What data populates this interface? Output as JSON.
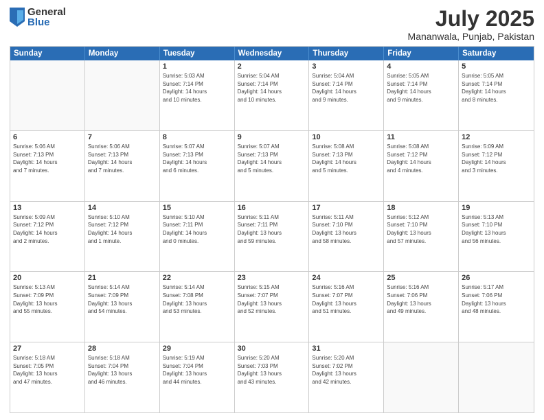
{
  "logo": {
    "general": "General",
    "blue": "Blue"
  },
  "header": {
    "month": "July 2025",
    "location": "Mananwala, Punjab, Pakistan"
  },
  "weekdays": [
    "Sunday",
    "Monday",
    "Tuesday",
    "Wednesday",
    "Thursday",
    "Friday",
    "Saturday"
  ],
  "weeks": [
    [
      {
        "day": "",
        "info": ""
      },
      {
        "day": "",
        "info": ""
      },
      {
        "day": "1",
        "info": "Sunrise: 5:03 AM\nSunset: 7:14 PM\nDaylight: 14 hours\nand 10 minutes."
      },
      {
        "day": "2",
        "info": "Sunrise: 5:04 AM\nSunset: 7:14 PM\nDaylight: 14 hours\nand 10 minutes."
      },
      {
        "day": "3",
        "info": "Sunrise: 5:04 AM\nSunset: 7:14 PM\nDaylight: 14 hours\nand 9 minutes."
      },
      {
        "day": "4",
        "info": "Sunrise: 5:05 AM\nSunset: 7:14 PM\nDaylight: 14 hours\nand 9 minutes."
      },
      {
        "day": "5",
        "info": "Sunrise: 5:05 AM\nSunset: 7:14 PM\nDaylight: 14 hours\nand 8 minutes."
      }
    ],
    [
      {
        "day": "6",
        "info": "Sunrise: 5:06 AM\nSunset: 7:13 PM\nDaylight: 14 hours\nand 7 minutes."
      },
      {
        "day": "7",
        "info": "Sunrise: 5:06 AM\nSunset: 7:13 PM\nDaylight: 14 hours\nand 7 minutes."
      },
      {
        "day": "8",
        "info": "Sunrise: 5:07 AM\nSunset: 7:13 PM\nDaylight: 14 hours\nand 6 minutes."
      },
      {
        "day": "9",
        "info": "Sunrise: 5:07 AM\nSunset: 7:13 PM\nDaylight: 14 hours\nand 5 minutes."
      },
      {
        "day": "10",
        "info": "Sunrise: 5:08 AM\nSunset: 7:13 PM\nDaylight: 14 hours\nand 5 minutes."
      },
      {
        "day": "11",
        "info": "Sunrise: 5:08 AM\nSunset: 7:12 PM\nDaylight: 14 hours\nand 4 minutes."
      },
      {
        "day": "12",
        "info": "Sunrise: 5:09 AM\nSunset: 7:12 PM\nDaylight: 14 hours\nand 3 minutes."
      }
    ],
    [
      {
        "day": "13",
        "info": "Sunrise: 5:09 AM\nSunset: 7:12 PM\nDaylight: 14 hours\nand 2 minutes."
      },
      {
        "day": "14",
        "info": "Sunrise: 5:10 AM\nSunset: 7:12 PM\nDaylight: 14 hours\nand 1 minute."
      },
      {
        "day": "15",
        "info": "Sunrise: 5:10 AM\nSunset: 7:11 PM\nDaylight: 14 hours\nand 0 minutes."
      },
      {
        "day": "16",
        "info": "Sunrise: 5:11 AM\nSunset: 7:11 PM\nDaylight: 13 hours\nand 59 minutes."
      },
      {
        "day": "17",
        "info": "Sunrise: 5:11 AM\nSunset: 7:10 PM\nDaylight: 13 hours\nand 58 minutes."
      },
      {
        "day": "18",
        "info": "Sunrise: 5:12 AM\nSunset: 7:10 PM\nDaylight: 13 hours\nand 57 minutes."
      },
      {
        "day": "19",
        "info": "Sunrise: 5:13 AM\nSunset: 7:10 PM\nDaylight: 13 hours\nand 56 minutes."
      }
    ],
    [
      {
        "day": "20",
        "info": "Sunrise: 5:13 AM\nSunset: 7:09 PM\nDaylight: 13 hours\nand 55 minutes."
      },
      {
        "day": "21",
        "info": "Sunrise: 5:14 AM\nSunset: 7:09 PM\nDaylight: 13 hours\nand 54 minutes."
      },
      {
        "day": "22",
        "info": "Sunrise: 5:14 AM\nSunset: 7:08 PM\nDaylight: 13 hours\nand 53 minutes."
      },
      {
        "day": "23",
        "info": "Sunrise: 5:15 AM\nSunset: 7:07 PM\nDaylight: 13 hours\nand 52 minutes."
      },
      {
        "day": "24",
        "info": "Sunrise: 5:16 AM\nSunset: 7:07 PM\nDaylight: 13 hours\nand 51 minutes."
      },
      {
        "day": "25",
        "info": "Sunrise: 5:16 AM\nSunset: 7:06 PM\nDaylight: 13 hours\nand 49 minutes."
      },
      {
        "day": "26",
        "info": "Sunrise: 5:17 AM\nSunset: 7:06 PM\nDaylight: 13 hours\nand 48 minutes."
      }
    ],
    [
      {
        "day": "27",
        "info": "Sunrise: 5:18 AM\nSunset: 7:05 PM\nDaylight: 13 hours\nand 47 minutes."
      },
      {
        "day": "28",
        "info": "Sunrise: 5:18 AM\nSunset: 7:04 PM\nDaylight: 13 hours\nand 46 minutes."
      },
      {
        "day": "29",
        "info": "Sunrise: 5:19 AM\nSunset: 7:04 PM\nDaylight: 13 hours\nand 44 minutes."
      },
      {
        "day": "30",
        "info": "Sunrise: 5:20 AM\nSunset: 7:03 PM\nDaylight: 13 hours\nand 43 minutes."
      },
      {
        "day": "31",
        "info": "Sunrise: 5:20 AM\nSunset: 7:02 PM\nDaylight: 13 hours\nand 42 minutes."
      },
      {
        "day": "",
        "info": ""
      },
      {
        "day": "",
        "info": ""
      }
    ]
  ]
}
